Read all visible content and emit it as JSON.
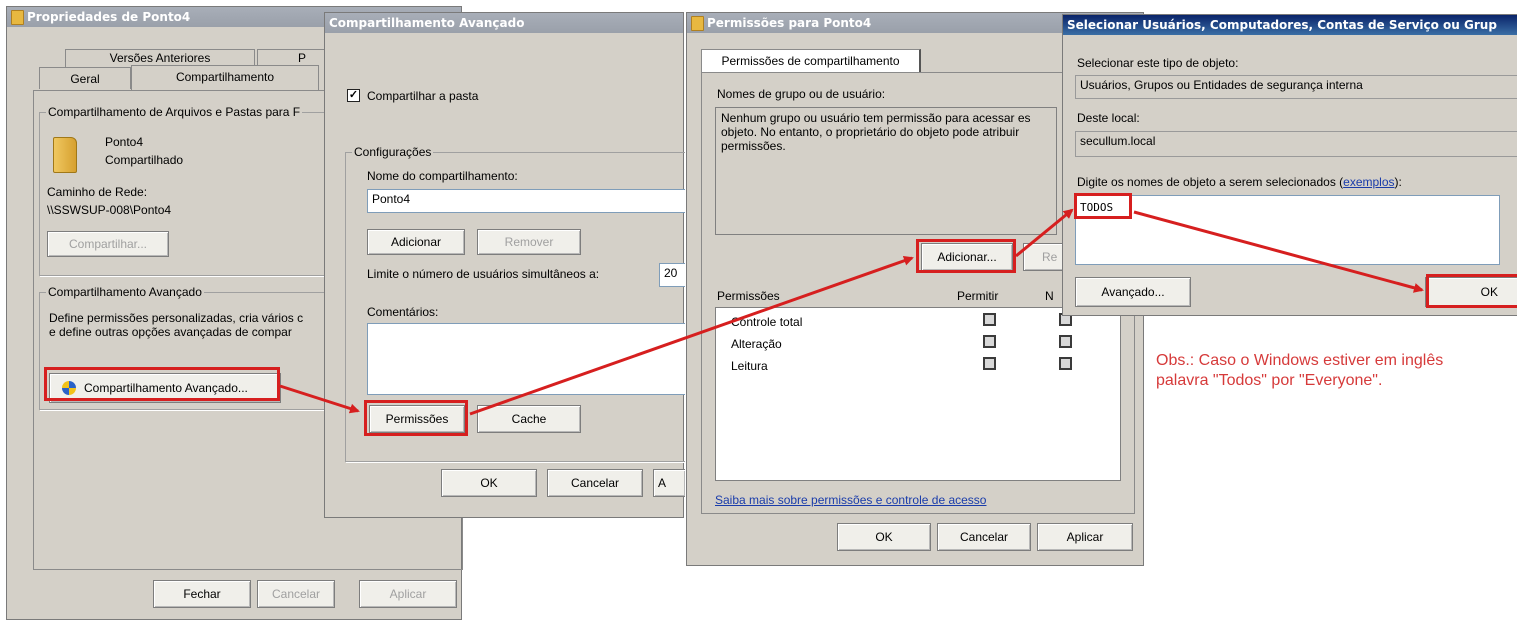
{
  "win1": {
    "title": "Propriedades de Ponto4",
    "tabs": [
      "Versões Anteriores",
      "P",
      "Geral",
      "Compartilhamento"
    ],
    "group_share_label": "Compartilhamento de Arquivos e Pastas para F",
    "folder_name": "Ponto4",
    "folder_status": "Compartilhado",
    "network_path_label": "Caminho de Rede:",
    "network_path": "\\\\SSWSUP-008\\Ponto4",
    "share_button": "Compartilhar...",
    "group_adv_label": "Compartilhamento Avançado",
    "adv_desc_line1": "Define permissões personalizadas, cria vários c",
    "adv_desc_line2": "e define outras opções avançadas de compar",
    "adv_button": "Compartilhamento Avançado...",
    "close_button": "Fechar",
    "cancel_button": "Cancelar",
    "apply_button": "Aplicar"
  },
  "win2": {
    "title": "Compartilhamento Avançado",
    "share_checkbox_label": "Compartilhar a pasta",
    "share_checkbox_mark": "✓",
    "group_config_label": "Configurações",
    "share_name_label": "Nome do compartilhamento:",
    "share_name_value": "Ponto4",
    "add_button": "Adicionar",
    "remove_button": "Remover",
    "limit_label": "Limite o número de usuários simultâneos a:",
    "limit_value": "20",
    "comments_label": "Comentários:",
    "permissions_button": "Permissões",
    "cache_button": "Cache",
    "ok_button": "OK",
    "cancel_button": "Cancelar",
    "apply_partial": "A"
  },
  "win3": {
    "title": "Permissões para Ponto4",
    "tab_label": "Permissões de compartilhamento",
    "group_names_label": "Nomes de grupo ou de usuário:",
    "empty_text_line1": "Nenhum grupo ou usuário tem permissão para acessar es",
    "empty_text_line2": "objeto. No entanto, o proprietário do objeto pode atribuir",
    "empty_text_line3": "permissões.",
    "add_button": "Adicionar...",
    "remove_partial": "Re",
    "permissions_header": "Permissões",
    "allow_header": "Permitir",
    "deny_partial": "N",
    "permissions": [
      {
        "name": "Controle total"
      },
      {
        "name": "Alteração"
      },
      {
        "name": "Leitura"
      }
    ],
    "help_link": "Saiba mais sobre permissões e controle de acesso",
    "ok_button": "OK",
    "cancel_button": "Cancelar",
    "apply_button": "Aplicar"
  },
  "win4": {
    "title": "Selecionar Usuários, Computadores, Contas de Serviço ou Grup",
    "object_type_label": "Selecionar este tipo de objeto:",
    "object_type_value": "Usuários, Grupos ou Entidades de segurança interna",
    "location_label": "Deste local:",
    "location_value": "secullum.local",
    "names_label_prefix": "Digite os nomes de objeto a serem selecionados (",
    "names_label_link": "exemplos",
    "names_label_suffix": "):",
    "names_value": "TODOS",
    "advanced_button": "Avançado...",
    "ok_button": "OK"
  },
  "note": {
    "line1": "Obs.: Caso o Windows estiver em inglês",
    "line2": "palavra \"Todos\" por \"Everyone\"."
  },
  "colors": {
    "highlight": "#d61f1f",
    "note_text": "#d63a3a",
    "active_title": "#0a246a",
    "dialog_bg": "#d4d0c8"
  }
}
